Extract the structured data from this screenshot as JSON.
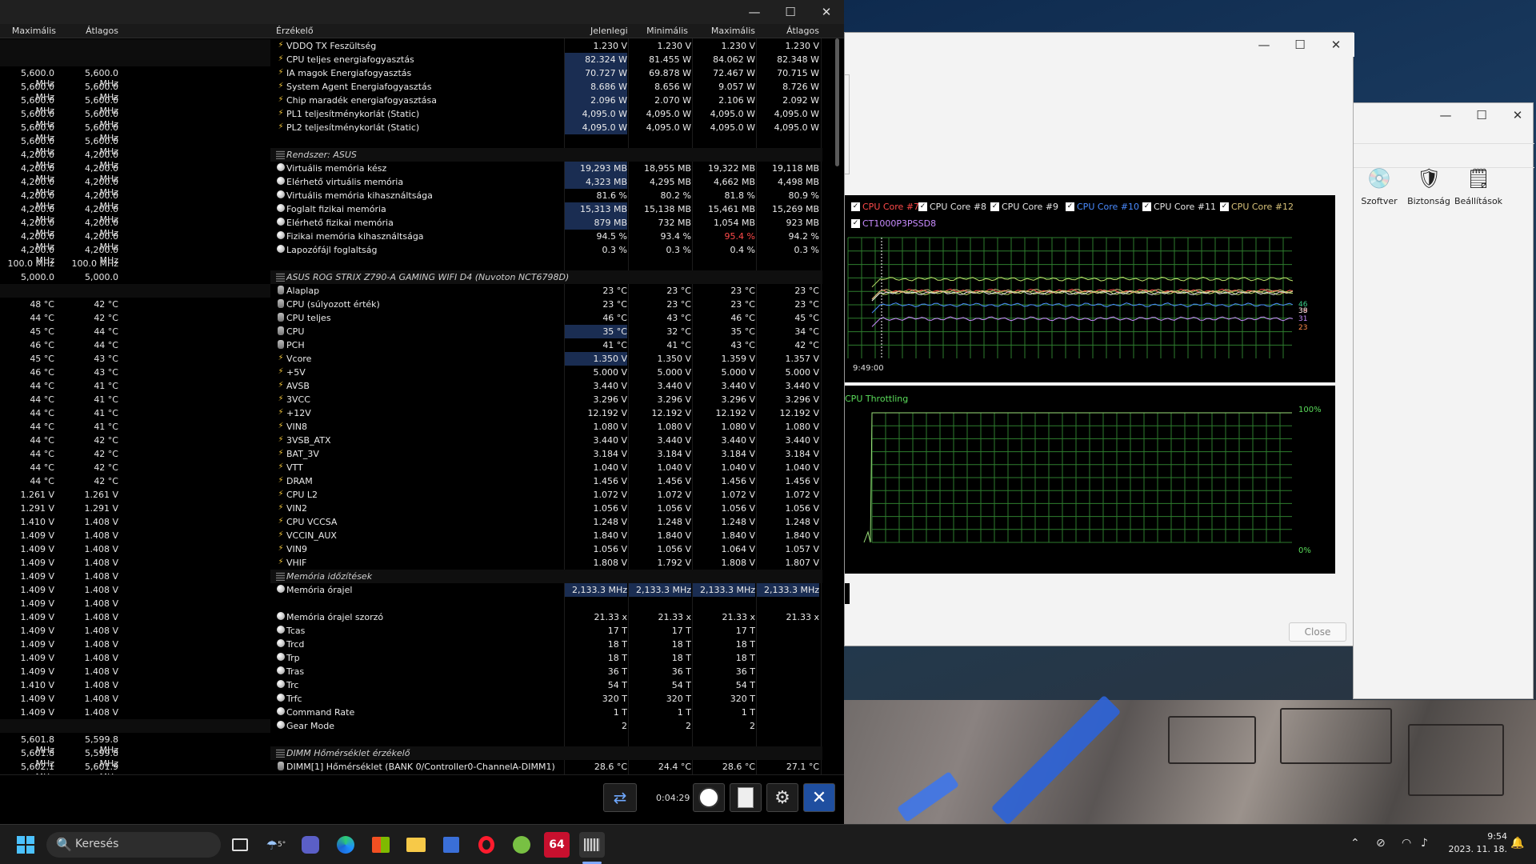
{
  "left_pane": {
    "headers": [
      "Maximális",
      "Átlagos"
    ],
    "rows": [
      [
        "",
        ""
      ],
      [
        "",
        ""
      ],
      [
        "5,600.0 MHz",
        "5,600.0 MHz"
      ],
      [
        "5,600.0 MHz",
        "5,600.0 MHz"
      ],
      [
        "5,600.0 MHz",
        "5,600.0 MHz"
      ],
      [
        "5,600.0 MHz",
        "5,600.0 MHz"
      ],
      [
        "5,600.0 MHz",
        "5,600.0 MHz"
      ],
      [
        "5,600.0 MHz",
        "5,600.0 MHz"
      ],
      [
        "4,200.0 MHz",
        "4,200.0 MHz"
      ],
      [
        "4,200.0 MHz",
        "4,200.0 MHz"
      ],
      [
        "4,200.0 MHz",
        "4,200.0 MHz"
      ],
      [
        "4,200.0 MHz",
        "4,200.0 MHz"
      ],
      [
        "4,200.0 MHz",
        "4,200.0 MHz"
      ],
      [
        "4,200.0 MHz",
        "4,200.0 MHz"
      ],
      [
        "4,200.0 MHz",
        "4,200.0 MHz"
      ],
      [
        "4,200.0 MHz",
        "4,200.0 MHz"
      ],
      [
        "100.0 MHz",
        "100.0 MHz"
      ],
      [
        "5,000.0 MHz",
        "5,000.0 MHz"
      ],
      [
        "",
        ""
      ],
      [
        "48 °C",
        "42 °C"
      ],
      [
        "44 °C",
        "42 °C"
      ],
      [
        "45 °C",
        "44 °C"
      ],
      [
        "46 °C",
        "44 °C"
      ],
      [
        "45 °C",
        "43 °C"
      ],
      [
        "46 °C",
        "43 °C"
      ],
      [
        "44 °C",
        "41 °C"
      ],
      [
        "44 °C",
        "41 °C"
      ],
      [
        "44 °C",
        "41 °C"
      ],
      [
        "44 °C",
        "41 °C"
      ],
      [
        "44 °C",
        "42 °C"
      ],
      [
        "44 °C",
        "42 °C"
      ],
      [
        "44 °C",
        "42 °C"
      ],
      [
        "44 °C",
        "42 °C"
      ],
      [
        "1.261 V",
        "1.261 V"
      ],
      [
        "1.291 V",
        "1.291 V"
      ],
      [
        "1.410 V",
        "1.408 V"
      ],
      [
        "1.409 V",
        "1.408 V"
      ],
      [
        "1.409 V",
        "1.408 V"
      ],
      [
        "1.409 V",
        "1.408 V"
      ],
      [
        "1.409 V",
        "1.408 V"
      ],
      [
        "1.409 V",
        "1.408 V"
      ],
      [
        "1.409 V",
        "1.408 V"
      ],
      [
        "1.409 V",
        "1.408 V"
      ],
      [
        "1.409 V",
        "1.408 V"
      ],
      [
        "1.409 V",
        "1.408 V"
      ],
      [
        "1.409 V",
        "1.408 V"
      ],
      [
        "1.409 V",
        "1.408 V"
      ],
      [
        "1.410 V",
        "1.408 V"
      ],
      [
        "1.409 V",
        "1.408 V"
      ],
      [
        "1.409 V",
        "1.408 V"
      ],
      [
        "",
        ""
      ],
      [
        "5,601.8 MHz",
        "5,599.8 MHz"
      ],
      [
        "5,601.8 MHz",
        "5,599.8 MHz"
      ],
      [
        "5,602.1 MHz",
        "5,601.9 MHz"
      ],
      [
        "5,602.1 MHz",
        "5,601.9 MHz"
      ]
    ]
  },
  "right_pane": {
    "headers": {
      "sensor": "Érzékelő",
      "current": "Jelenlegi",
      "min": "Minimális",
      "max": "Maximális",
      "avg": "Átlagos"
    },
    "rows": [
      {
        "t": "v",
        "n": "VDDQ TX Feszültség",
        "c": "1.230 V",
        "mi": "1.230 V",
        "ma": "1.230 V",
        "a": "1.230 V"
      },
      {
        "t": "v",
        "n": "CPU teljes energiafogyasztás",
        "c": "82.324 W",
        "mi": "81.455 W",
        "ma": "84.062 W",
        "a": "82.348 W",
        "hl": true
      },
      {
        "t": "v",
        "n": "IA magok Energiafogyasztás",
        "c": "70.727 W",
        "mi": "69.878 W",
        "ma": "72.467 W",
        "a": "70.715 W",
        "hl": true
      },
      {
        "t": "v",
        "n": "System Agent Energiafogyasztás",
        "c": "8.686 W",
        "mi": "8.656 W",
        "ma": "9.057 W",
        "a": "8.726 W",
        "hl": true
      },
      {
        "t": "v",
        "n": "Chip maradék energiafogyasztása",
        "c": "2.096 W",
        "mi": "2.070 W",
        "ma": "2.106 W",
        "a": "2.092 W",
        "hl": true
      },
      {
        "t": "v",
        "n": "PL1 teljesítménykorlát (Static)",
        "c": "4,095.0 W",
        "mi": "4,095.0 W",
        "ma": "4,095.0 W",
        "a": "4,095.0 W",
        "hl": true
      },
      {
        "t": "v",
        "n": "PL2 teljesítménykorlát (Static)",
        "c": "4,095.0 W",
        "mi": "4,095.0 W",
        "ma": "4,095.0 W",
        "a": "4,095.0 W",
        "hl": true
      },
      {
        "t": "blank"
      },
      {
        "t": "g",
        "n": "Rendszer: ASUS"
      },
      {
        "t": "c",
        "n": "Virtuális memória kész",
        "c": "19,293 MB",
        "mi": "18,955 MB",
        "ma": "19,322 MB",
        "a": "19,118 MB",
        "hl": true
      },
      {
        "t": "c",
        "n": "Elérhető virtuális memória",
        "c": "4,323 MB",
        "mi": "4,295 MB",
        "ma": "4,662 MB",
        "a": "4,498 MB",
        "hl": true
      },
      {
        "t": "c",
        "n": "Virtuális memória kihasználtsága",
        "c": "81.6 %",
        "mi": "80.2 %",
        "ma": "81.8 %",
        "a": "80.9 %"
      },
      {
        "t": "c",
        "n": "Foglalt fizikai memória",
        "c": "15,313 MB",
        "mi": "15,138 MB",
        "ma": "15,461 MB",
        "a": "15,269 MB",
        "hl": true
      },
      {
        "t": "c",
        "n": "Elérhető fizikai memória",
        "c": "879 MB",
        "mi": "732 MB",
        "ma": "1,054 MB",
        "a": "923 MB",
        "hl": true
      },
      {
        "t": "c",
        "n": "Fizikai memória kihasználtsága",
        "c": "94.5 %",
        "mi": "93.4 %",
        "ma": "95.4 %",
        "a": "94.2 %",
        "red": true
      },
      {
        "t": "c",
        "n": "Lapozófájl foglaltság",
        "c": "0.3 %",
        "mi": "0.3 %",
        "ma": "0.4 %",
        "a": "0.3 %"
      },
      {
        "t": "blank"
      },
      {
        "t": "g",
        "n": "ASUS ROG STRIX Z790-A GAMING WIFI D4 (Nuvoton NCT6798D)"
      },
      {
        "t": "th",
        "n": "Alaplap",
        "c": "23 °C",
        "mi": "23 °C",
        "ma": "23 °C",
        "a": "23 °C"
      },
      {
        "t": "th",
        "n": "CPU (súlyozott érték)",
        "c": "23 °C",
        "mi": "23 °C",
        "ma": "23 °C",
        "a": "23 °C"
      },
      {
        "t": "th",
        "n": "CPU teljes",
        "c": "46 °C",
        "mi": "43 °C",
        "ma": "46 °C",
        "a": "45 °C"
      },
      {
        "t": "th",
        "n": "CPU",
        "c": "35 °C",
        "mi": "32 °C",
        "ma": "35 °C",
        "a": "34 °C",
        "hl": true
      },
      {
        "t": "th",
        "n": "PCH",
        "c": "41 °C",
        "mi": "41 °C",
        "ma": "43 °C",
        "a": "42 °C"
      },
      {
        "t": "v",
        "n": "Vcore",
        "c": "1.350 V",
        "mi": "1.350 V",
        "ma": "1.359 V",
        "a": "1.357 V",
        "hl": true
      },
      {
        "t": "v",
        "n": "+5V",
        "c": "5.000 V",
        "mi": "5.000 V",
        "ma": "5.000 V",
        "a": "5.000 V"
      },
      {
        "t": "v",
        "n": "AVSB",
        "c": "3.440 V",
        "mi": "3.440 V",
        "ma": "3.440 V",
        "a": "3.440 V"
      },
      {
        "t": "v",
        "n": "3VCC",
        "c": "3.296 V",
        "mi": "3.296 V",
        "ma": "3.296 V",
        "a": "3.296 V"
      },
      {
        "t": "v",
        "n": "+12V",
        "c": "12.192 V",
        "mi": "12.192 V",
        "ma": "12.192 V",
        "a": "12.192 V"
      },
      {
        "t": "v",
        "n": "VIN8",
        "c": "1.080 V",
        "mi": "1.080 V",
        "ma": "1.080 V",
        "a": "1.080 V"
      },
      {
        "t": "v",
        "n": "3VSB_ATX",
        "c": "3.440 V",
        "mi": "3.440 V",
        "ma": "3.440 V",
        "a": "3.440 V"
      },
      {
        "t": "v",
        "n": "BAT_3V",
        "c": "3.184 V",
        "mi": "3.184 V",
        "ma": "3.184 V",
        "a": "3.184 V"
      },
      {
        "t": "v",
        "n": "VTT",
        "c": "1.040 V",
        "mi": "1.040 V",
        "ma": "1.040 V",
        "a": "1.040 V"
      },
      {
        "t": "v",
        "n": "DRAM",
        "c": "1.456 V",
        "mi": "1.456 V",
        "ma": "1.456 V",
        "a": "1.456 V"
      },
      {
        "t": "v",
        "n": "CPU L2",
        "c": "1.072 V",
        "mi": "1.072 V",
        "ma": "1.072 V",
        "a": "1.072 V"
      },
      {
        "t": "v",
        "n": "VIN2",
        "c": "1.056 V",
        "mi": "1.056 V",
        "ma": "1.056 V",
        "a": "1.056 V"
      },
      {
        "t": "v",
        "n": "CPU VCCSA",
        "c": "1.248 V",
        "mi": "1.248 V",
        "ma": "1.248 V",
        "a": "1.248 V"
      },
      {
        "t": "v",
        "n": "VCCIN_AUX",
        "c": "1.840 V",
        "mi": "1.840 V",
        "ma": "1.840 V",
        "a": "1.840 V"
      },
      {
        "t": "v",
        "n": "VIN9",
        "c": "1.056 V",
        "mi": "1.056 V",
        "ma": "1.064 V",
        "a": "1.057 V"
      },
      {
        "t": "v",
        "n": "VHIF",
        "c": "1.808 V",
        "mi": "1.792 V",
        "ma": "1.808 V",
        "a": "1.807 V"
      },
      {
        "t": "g",
        "n": "Memória időzítések"
      },
      {
        "t": "c",
        "n": "Memória órajel",
        "c": "2,133.3 MHz",
        "mi": "2,133.3 MHz",
        "ma": "2,133.3 MHz",
        "a": "2,133.3 MHz",
        "hlall": true
      },
      {
        "t": "blank"
      },
      {
        "t": "c",
        "n": "Memória órajel szorzó",
        "c": "21.33 x",
        "mi": "21.33 x",
        "ma": "21.33 x",
        "a": "21.33 x"
      },
      {
        "t": "c",
        "n": "Tcas",
        "c": "17 T",
        "mi": "17 T",
        "ma": "17 T",
        "a": ""
      },
      {
        "t": "c",
        "n": "Trcd",
        "c": "18 T",
        "mi": "18 T",
        "ma": "18 T",
        "a": ""
      },
      {
        "t": "c",
        "n": "Trp",
        "c": "18 T",
        "mi": "18 T",
        "ma": "18 T",
        "a": ""
      },
      {
        "t": "c",
        "n": "Tras",
        "c": "36 T",
        "mi": "36 T",
        "ma": "36 T",
        "a": ""
      },
      {
        "t": "c",
        "n": "Trc",
        "c": "54 T",
        "mi": "54 T",
        "ma": "54 T",
        "a": ""
      },
      {
        "t": "c",
        "n": "Trfc",
        "c": "320 T",
        "mi": "320 T",
        "ma": "320 T",
        "a": ""
      },
      {
        "t": "c",
        "n": "Command Rate",
        "c": "1 T",
        "mi": "1 T",
        "ma": "1 T",
        "a": ""
      },
      {
        "t": "c",
        "n": "Gear Mode",
        "c": "2",
        "mi": "2",
        "ma": "2",
        "a": ""
      },
      {
        "t": "blank"
      },
      {
        "t": "g",
        "n": "DIMM Hőmérséklet érzékelő"
      },
      {
        "t": "th",
        "n": "DIMM[1] Hőmérséklet (BANK 0/Controller0-ChannelA-DIMM1)",
        "c": "28.6 °C",
        "mi": "24.4 °C",
        "ma": "28.6 °C",
        "a": "27.1 °C"
      }
    ]
  },
  "hw_bottom": {
    "elapsed": "0:04:29"
  },
  "graph_window": {
    "legend": [
      {
        "label": "CPU Core #7",
        "color": "#ff4a4a"
      },
      {
        "label": "CPU Core #8",
        "color": "#e6e6e6"
      },
      {
        "label": "CPU Core #9",
        "color": "#e6e6e6"
      },
      {
        "label": "CPU Core #10",
        "color": "#4a8bff"
      },
      {
        "label": "CPU Core #11",
        "color": "#e6e6e6"
      },
      {
        "label": "CPU Core #12",
        "color": "#d8c27a"
      },
      {
        "label": "CT1000P3PSSD8",
        "color": "#c98cff"
      }
    ],
    "top_graph": {
      "time_label": "9:49:00",
      "end_labels": [
        {
          "text": "46",
          "color": "#3ad18c"
        },
        {
          "text": "39",
          "color": "#ff6a6a"
        },
        {
          "text": "38",
          "color": "#e6e6e6"
        },
        {
          "text": "31",
          "color": "#c98cff"
        },
        {
          "text": "23",
          "color": "#ff8a4a"
        }
      ]
    },
    "bottom_graph": {
      "title": "CPU Throttling",
      "max_label": "100%",
      "min_label": "0%"
    },
    "close_label": "Close"
  },
  "security_window": {
    "icons": [
      {
        "label": "Szoftver",
        "glyph": "💿"
      },
      {
        "label": "Biztonság",
        "glyph": "🛡"
      },
      {
        "label": "Beállítások",
        "glyph": "🗒"
      }
    ]
  },
  "taskbar": {
    "search_placeholder": "Keresés",
    "weather": "5°",
    "aida_label": "64",
    "time": "9:54",
    "date": "2023. 11. 18."
  },
  "chart_data": [
    {
      "type": "line",
      "title": "",
      "series": [
        {
          "name": "CPU Core #7",
          "values": [
            39
          ]
        },
        {
          "name": "CPU Core #8",
          "values": [
            38
          ]
        },
        {
          "name": "CPU Core #9",
          "values": [
            38
          ]
        },
        {
          "name": "CPU Core #10",
          "values": [
            31
          ]
        },
        {
          "name": "CPU Core #11",
          "values": [
            46
          ]
        },
        {
          "name": "CPU Core #12",
          "values": [
            39
          ]
        },
        {
          "name": "CT1000P3PSSD8",
          "values": [
            23
          ]
        }
      ],
      "x_tick_labels": [
        "9:49:00"
      ]
    },
    {
      "type": "line",
      "title": "CPU Throttling",
      "ylim": [
        0,
        100
      ],
      "y_tick_labels": [
        "0%",
        "100%"
      ],
      "series": [
        {
          "values": [
            0,
            8,
            0,
            100,
            100,
            100,
            100,
            100,
            100,
            100,
            100
          ]
        }
      ]
    }
  ]
}
